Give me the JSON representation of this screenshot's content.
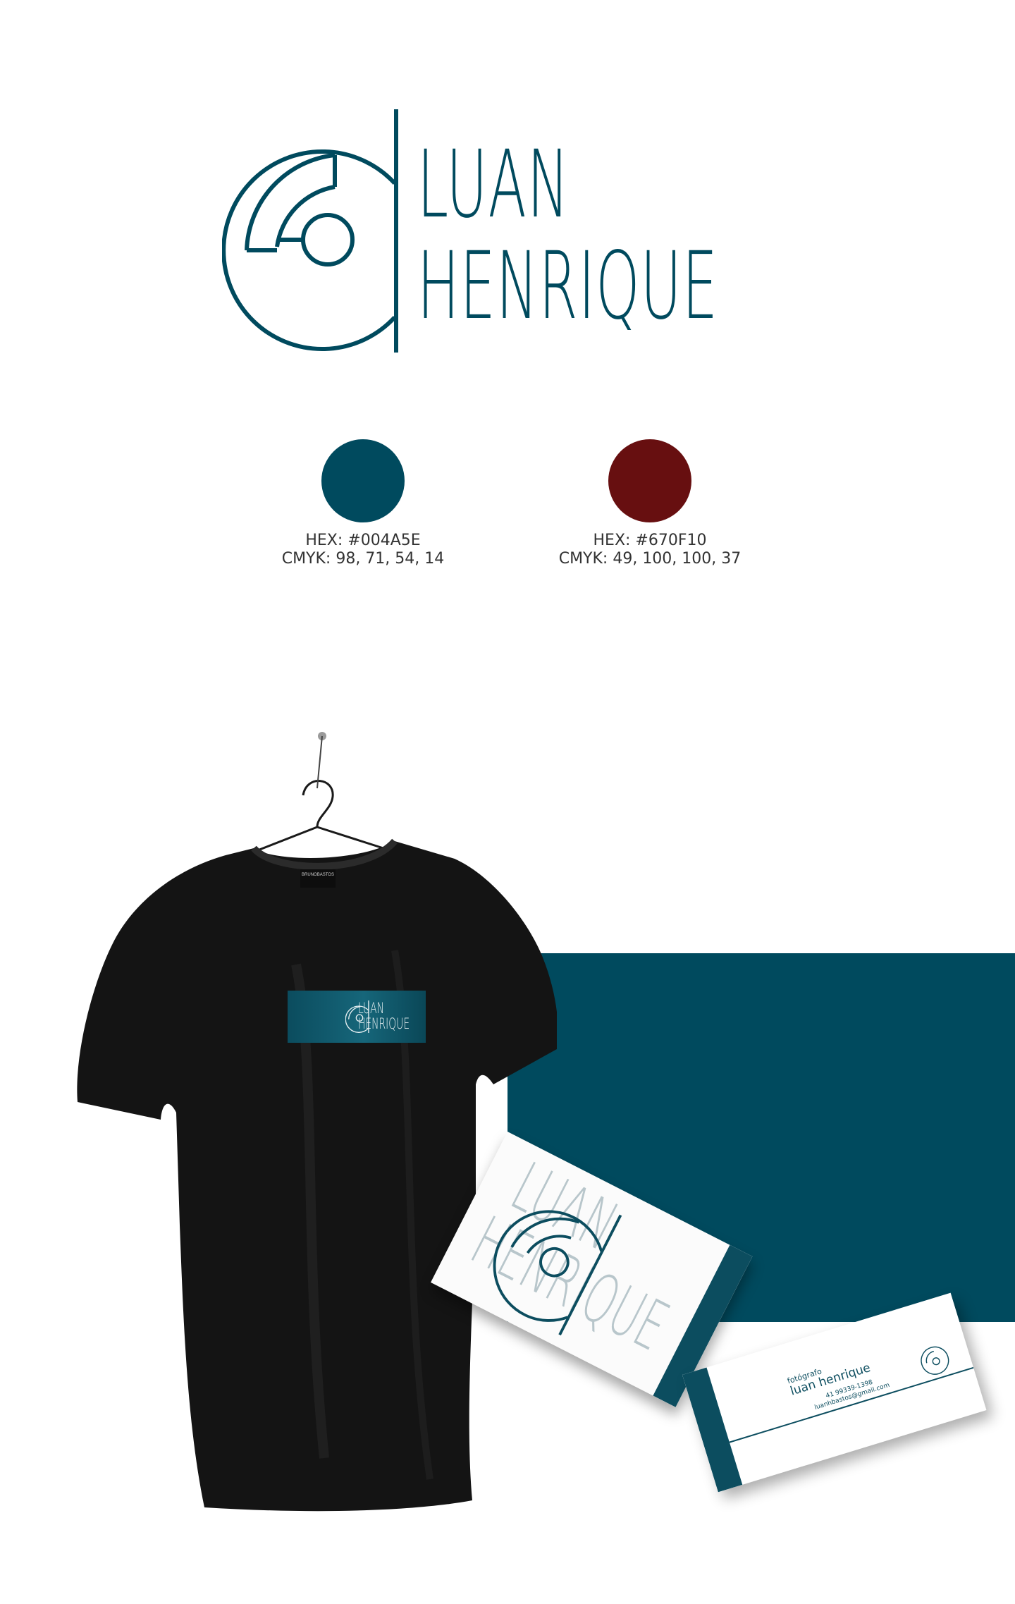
{
  "brand": {
    "name_line1": "LUAN",
    "name_line2": "HENRIQUE"
  },
  "colors": {
    "primary": "#004A5E",
    "secondary": "#670F10"
  },
  "swatches": [
    {
      "hex_label": "HEX: #004A5E",
      "cmyk_label": "CMYK: 98, 71, 54, 14",
      "color": "#004A5E"
    },
    {
      "hex_label": "HEX: #670F10",
      "cmyk_label": "CMYK: 49, 100, 100, 37",
      "color": "#670F10"
    }
  ],
  "mockup": {
    "shirt_tag": "BRUNOBASTOS",
    "card_back": {
      "role": "fotógrafo",
      "name": "luan henrique",
      "phone": "41 99339-1398",
      "email": "luanhbastos@gmail.com"
    }
  }
}
